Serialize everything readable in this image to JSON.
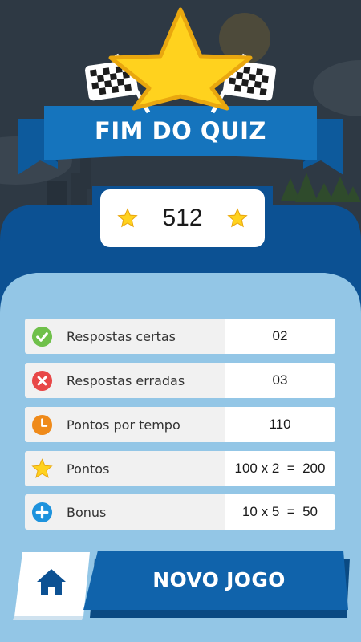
{
  "title": "FIM DO QUIZ",
  "score": "512",
  "stats": [
    {
      "label": "Respostas certas",
      "value": "02",
      "icon": "check-icon"
    },
    {
      "label": "Respostas erradas",
      "value": "03",
      "icon": "wrong-icon"
    },
    {
      "label": "Pontos por tempo",
      "value": "110",
      "icon": "clock-icon"
    },
    {
      "label": "Pontos",
      "value": "100 x 2  =  200",
      "icon": "star-icon"
    },
    {
      "label": "Bonus",
      "value": "10 x 5  =  50",
      "icon": "plus-icon"
    }
  ],
  "buttons": {
    "home_icon": "home-icon",
    "new_game_label": "NOVO JOGO"
  },
  "colors": {
    "primary_blue": "#0f5fa0",
    "dark_blue": "#0a4a83",
    "panel_light_blue": "#93c6e6",
    "star_yellow": "#ffd21e",
    "green": "#6fc04a",
    "red": "#e84848",
    "orange": "#ef8a1a",
    "cyan": "#1e93dd"
  }
}
